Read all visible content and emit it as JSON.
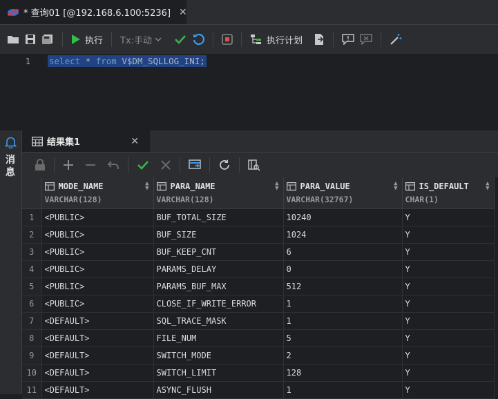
{
  "editor_tab": {
    "title": "* 查询01 [@192.168.6.100:5236]",
    "close": "✕"
  },
  "toolbar": {
    "run_label": "执行",
    "tx_label": "Tx:手动",
    "plan_label": "执行计划"
  },
  "editor": {
    "line_number": "1",
    "sql_keyword1": "select",
    "sql_mid": " * ",
    "sql_keyword2": "from",
    "sql_rest": " V$DM_SQLLOG_INI;"
  },
  "side_panel": {
    "label": "消息"
  },
  "result_tab": {
    "title": "结果集1",
    "close": "✕"
  },
  "grid": {
    "columns": [
      {
        "name": "MODE_NAME",
        "type": "VARCHAR(128)"
      },
      {
        "name": "PARA_NAME",
        "type": "VARCHAR(128)"
      },
      {
        "name": "PARA_VALUE",
        "type": "VARCHAR(32767)"
      },
      {
        "name": "IS_DEFAULT",
        "type": "CHAR(1)"
      }
    ],
    "rows": [
      [
        "1",
        "<PUBLIC>",
        "BUF_TOTAL_SIZE",
        "10240",
        "Y"
      ],
      [
        "2",
        "<PUBLIC>",
        "BUF_SIZE",
        "1024",
        "Y"
      ],
      [
        "3",
        "<PUBLIC>",
        "BUF_KEEP_CNT",
        "6",
        "Y"
      ],
      [
        "4",
        "<PUBLIC>",
        "PARAMS_DELAY",
        "0",
        "Y"
      ],
      [
        "5",
        "<PUBLIC>",
        "PARAMS_BUF_MAX",
        "512",
        "Y"
      ],
      [
        "6",
        "<PUBLIC>",
        "CLOSE_IF_WRITE_ERROR",
        "1",
        "Y"
      ],
      [
        "7",
        "<DEFAULT>",
        "SQL_TRACE_MASK",
        "1",
        "Y"
      ],
      [
        "8",
        "<DEFAULT>",
        "FILE_NUM",
        "5",
        "Y"
      ],
      [
        "9",
        "<DEFAULT>",
        "SWITCH_MODE",
        "2",
        "Y"
      ],
      [
        "10",
        "<DEFAULT>",
        "SWITCH_LIMIT",
        "128",
        "Y"
      ],
      [
        "11",
        "<DEFAULT>",
        "ASYNC_FLUSH",
        "1",
        "Y"
      ]
    ]
  },
  "colors": {
    "run_green": "#2fbf4a",
    "check_green": "#3ab54a",
    "undo_blue": "#3d9bf0",
    "stop_red": "#d9534f",
    "selection": "#214283"
  }
}
